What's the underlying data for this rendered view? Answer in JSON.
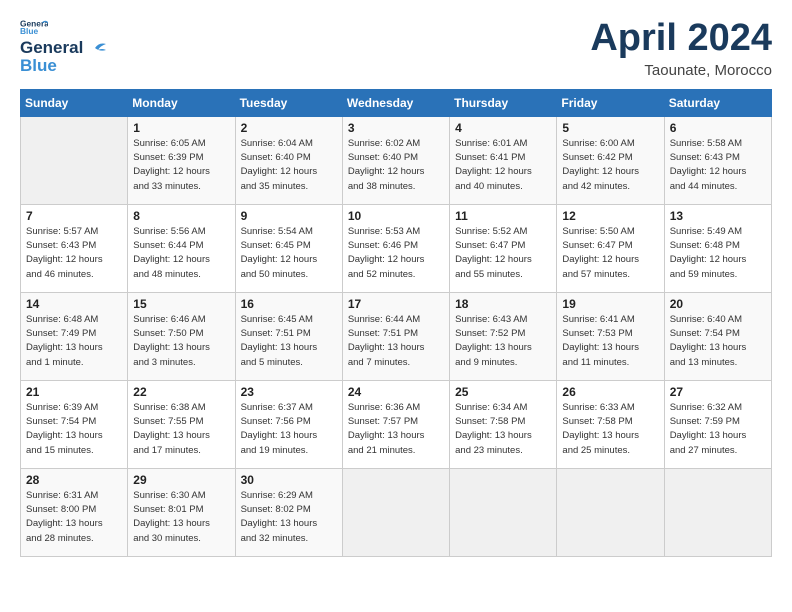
{
  "logo": {
    "line1": "General",
    "line2": "Blue"
  },
  "title": "April 2024",
  "location": "Taounate, Morocco",
  "header": {
    "days": [
      "Sunday",
      "Monday",
      "Tuesday",
      "Wednesday",
      "Thursday",
      "Friday",
      "Saturday"
    ]
  },
  "weeks": [
    [
      {
        "day": "",
        "info": ""
      },
      {
        "day": "1",
        "info": "Sunrise: 6:05 AM\nSunset: 6:39 PM\nDaylight: 12 hours\nand 33 minutes."
      },
      {
        "day": "2",
        "info": "Sunrise: 6:04 AM\nSunset: 6:40 PM\nDaylight: 12 hours\nand 35 minutes."
      },
      {
        "day": "3",
        "info": "Sunrise: 6:02 AM\nSunset: 6:40 PM\nDaylight: 12 hours\nand 38 minutes."
      },
      {
        "day": "4",
        "info": "Sunrise: 6:01 AM\nSunset: 6:41 PM\nDaylight: 12 hours\nand 40 minutes."
      },
      {
        "day": "5",
        "info": "Sunrise: 6:00 AM\nSunset: 6:42 PM\nDaylight: 12 hours\nand 42 minutes."
      },
      {
        "day": "6",
        "info": "Sunrise: 5:58 AM\nSunset: 6:43 PM\nDaylight: 12 hours\nand 44 minutes."
      }
    ],
    [
      {
        "day": "7",
        "info": "Sunrise: 5:57 AM\nSunset: 6:43 PM\nDaylight: 12 hours\nand 46 minutes."
      },
      {
        "day": "8",
        "info": "Sunrise: 5:56 AM\nSunset: 6:44 PM\nDaylight: 12 hours\nand 48 minutes."
      },
      {
        "day": "9",
        "info": "Sunrise: 5:54 AM\nSunset: 6:45 PM\nDaylight: 12 hours\nand 50 minutes."
      },
      {
        "day": "10",
        "info": "Sunrise: 5:53 AM\nSunset: 6:46 PM\nDaylight: 12 hours\nand 52 minutes."
      },
      {
        "day": "11",
        "info": "Sunrise: 5:52 AM\nSunset: 6:47 PM\nDaylight: 12 hours\nand 55 minutes."
      },
      {
        "day": "12",
        "info": "Sunrise: 5:50 AM\nSunset: 6:47 PM\nDaylight: 12 hours\nand 57 minutes."
      },
      {
        "day": "13",
        "info": "Sunrise: 5:49 AM\nSunset: 6:48 PM\nDaylight: 12 hours\nand 59 minutes."
      }
    ],
    [
      {
        "day": "14",
        "info": "Sunrise: 6:48 AM\nSunset: 7:49 PM\nDaylight: 13 hours\nand 1 minute."
      },
      {
        "day": "15",
        "info": "Sunrise: 6:46 AM\nSunset: 7:50 PM\nDaylight: 13 hours\nand 3 minutes."
      },
      {
        "day": "16",
        "info": "Sunrise: 6:45 AM\nSunset: 7:51 PM\nDaylight: 13 hours\nand 5 minutes."
      },
      {
        "day": "17",
        "info": "Sunrise: 6:44 AM\nSunset: 7:51 PM\nDaylight: 13 hours\nand 7 minutes."
      },
      {
        "day": "18",
        "info": "Sunrise: 6:43 AM\nSunset: 7:52 PM\nDaylight: 13 hours\nand 9 minutes."
      },
      {
        "day": "19",
        "info": "Sunrise: 6:41 AM\nSunset: 7:53 PM\nDaylight: 13 hours\nand 11 minutes."
      },
      {
        "day": "20",
        "info": "Sunrise: 6:40 AM\nSunset: 7:54 PM\nDaylight: 13 hours\nand 13 minutes."
      }
    ],
    [
      {
        "day": "21",
        "info": "Sunrise: 6:39 AM\nSunset: 7:54 PM\nDaylight: 13 hours\nand 15 minutes."
      },
      {
        "day": "22",
        "info": "Sunrise: 6:38 AM\nSunset: 7:55 PM\nDaylight: 13 hours\nand 17 minutes."
      },
      {
        "day": "23",
        "info": "Sunrise: 6:37 AM\nSunset: 7:56 PM\nDaylight: 13 hours\nand 19 minutes."
      },
      {
        "day": "24",
        "info": "Sunrise: 6:36 AM\nSunset: 7:57 PM\nDaylight: 13 hours\nand 21 minutes."
      },
      {
        "day": "25",
        "info": "Sunrise: 6:34 AM\nSunset: 7:58 PM\nDaylight: 13 hours\nand 23 minutes."
      },
      {
        "day": "26",
        "info": "Sunrise: 6:33 AM\nSunset: 7:58 PM\nDaylight: 13 hours\nand 25 minutes."
      },
      {
        "day": "27",
        "info": "Sunrise: 6:32 AM\nSunset: 7:59 PM\nDaylight: 13 hours\nand 27 minutes."
      }
    ],
    [
      {
        "day": "28",
        "info": "Sunrise: 6:31 AM\nSunset: 8:00 PM\nDaylight: 13 hours\nand 28 minutes."
      },
      {
        "day": "29",
        "info": "Sunrise: 6:30 AM\nSunset: 8:01 PM\nDaylight: 13 hours\nand 30 minutes."
      },
      {
        "day": "30",
        "info": "Sunrise: 6:29 AM\nSunset: 8:02 PM\nDaylight: 13 hours\nand 32 minutes."
      },
      {
        "day": "",
        "info": ""
      },
      {
        "day": "",
        "info": ""
      },
      {
        "day": "",
        "info": ""
      },
      {
        "day": "",
        "info": ""
      }
    ]
  ]
}
